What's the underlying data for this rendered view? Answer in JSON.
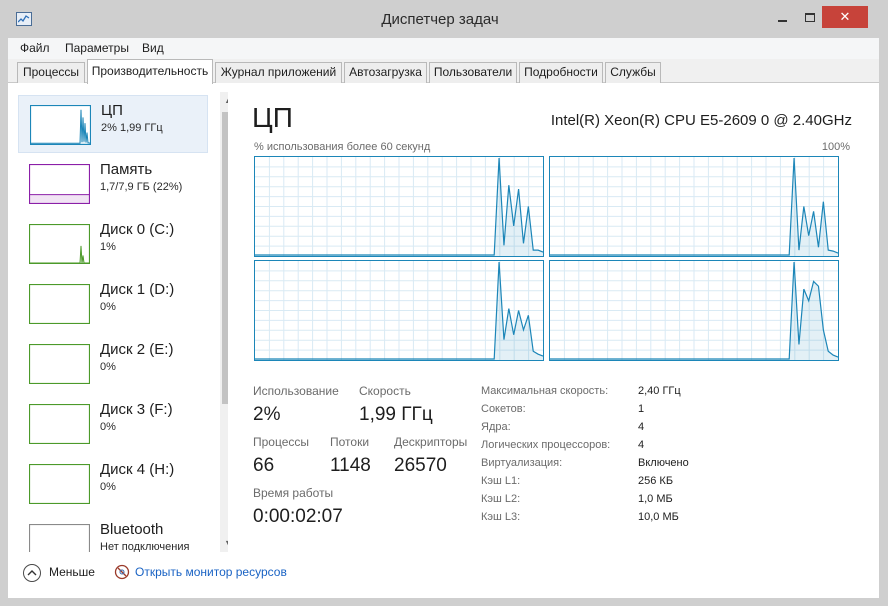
{
  "window": {
    "title": "Диспетчер задач",
    "controls": {
      "minimize": "",
      "maximize": "",
      "close": "✕"
    }
  },
  "menu": [
    "Файл",
    "Параметры",
    "Вид"
  ],
  "tabs": [
    {
      "label": "Процессы",
      "active": false
    },
    {
      "label": "Производительность",
      "active": true
    },
    {
      "label": "Журнал приложений",
      "active": false
    },
    {
      "label": "Автозагрузка",
      "active": false
    },
    {
      "label": "Пользователи",
      "active": false
    },
    {
      "label": "Подробности",
      "active": false
    },
    {
      "label": "Службы",
      "active": false
    }
  ],
  "sidebar": {
    "items": [
      {
        "name": "ЦП",
        "value": "2% 1,99 ГГц",
        "color": "#1c86b8",
        "selected": true,
        "series": [
          2,
          2,
          2,
          2,
          2,
          2,
          2,
          2,
          2,
          2,
          2,
          2,
          2,
          2,
          2,
          2,
          2,
          2,
          2,
          2,
          2,
          2,
          2,
          2,
          2,
          2,
          2,
          2,
          2,
          2,
          2,
          2,
          2,
          2,
          2,
          2,
          2,
          2,
          2,
          2,
          2,
          2,
          2,
          2,
          2,
          2,
          2,
          2,
          2,
          2,
          90,
          5,
          70,
          6,
          55,
          4,
          30,
          3,
          3,
          2
        ]
      },
      {
        "name": "Память",
        "value": "1,7/7,9 ГБ (22%)",
        "color": "#8b1fa8",
        "selected": false,
        "series": [
          22,
          22,
          22,
          22,
          22,
          22,
          22,
          22,
          22,
          22,
          22,
          22,
          22,
          22,
          22,
          22,
          22,
          22,
          22,
          22,
          22,
          22,
          22,
          22,
          22,
          22,
          22,
          22,
          22,
          22,
          22,
          22,
          22,
          22,
          22,
          22,
          22,
          22,
          22,
          22,
          22,
          22,
          22,
          22,
          22,
          22,
          22,
          22,
          22,
          22,
          22,
          22,
          22,
          22,
          22,
          22,
          22,
          22,
          22,
          22
        ]
      },
      {
        "name": "Диск 0 (C:)",
        "value": "1%",
        "color": "#4c9a2a",
        "selected": false,
        "series": [
          0,
          0,
          0,
          0,
          0,
          0,
          0,
          0,
          0,
          0,
          0,
          0,
          0,
          0,
          0,
          0,
          0,
          0,
          0,
          0,
          0,
          0,
          0,
          0,
          0,
          0,
          0,
          0,
          0,
          0,
          0,
          0,
          0,
          0,
          0,
          0,
          0,
          0,
          0,
          0,
          0,
          0,
          0,
          0,
          0,
          0,
          0,
          0,
          0,
          0,
          0,
          45,
          0,
          20,
          0,
          0,
          0,
          0,
          0,
          0
        ]
      },
      {
        "name": "Диск 1 (D:)",
        "value": "0%",
        "color": "#4c9a2a",
        "selected": false,
        "series": []
      },
      {
        "name": "Диск 2 (E:)",
        "value": "0%",
        "color": "#4c9a2a",
        "selected": false,
        "series": []
      },
      {
        "name": "Диск 3 (F:)",
        "value": "0%",
        "color": "#4c9a2a",
        "selected": false,
        "series": []
      },
      {
        "name": "Диск 4 (H:)",
        "value": "0%",
        "color": "#4c9a2a",
        "selected": false,
        "series": []
      },
      {
        "name": "Bluetooth",
        "value": "Нет подключения",
        "color": "#8a8a8a",
        "selected": false,
        "series": []
      }
    ]
  },
  "main": {
    "title": "ЦП",
    "cpu_model": "Intel(R) Xeon(R) CPU E5-2609 0 @ 2.40GHz",
    "graph_label": "% использования более 60 секунд",
    "graph_max": "100%",
    "line_color": "#1c86b8",
    "cores": [
      [
        0,
        0,
        0,
        0,
        0,
        0,
        0,
        0,
        0,
        0,
        0,
        0,
        0,
        0,
        0,
        0,
        0,
        0,
        0,
        0,
        0,
        0,
        0,
        0,
        0,
        0,
        0,
        0,
        0,
        0,
        0,
        0,
        0,
        0,
        0,
        0,
        0,
        0,
        0,
        0,
        0,
        0,
        0,
        0,
        0,
        0,
        0,
        0,
        0,
        0,
        100,
        10,
        72,
        30,
        68,
        12,
        50,
        5,
        5,
        3
      ],
      [
        0,
        0,
        0,
        0,
        0,
        0,
        0,
        0,
        0,
        0,
        0,
        0,
        0,
        0,
        0,
        0,
        0,
        0,
        0,
        0,
        0,
        0,
        0,
        0,
        0,
        0,
        0,
        0,
        0,
        0,
        0,
        0,
        0,
        0,
        0,
        0,
        0,
        0,
        0,
        0,
        0,
        0,
        0,
        0,
        0,
        0,
        0,
        0,
        0,
        0,
        100,
        5,
        50,
        20,
        45,
        8,
        55,
        5,
        4,
        2
      ],
      [
        0,
        0,
        0,
        0,
        0,
        0,
        0,
        0,
        0,
        0,
        0,
        0,
        0,
        0,
        0,
        0,
        0,
        0,
        0,
        0,
        0,
        0,
        0,
        0,
        0,
        0,
        0,
        0,
        0,
        0,
        0,
        0,
        0,
        0,
        0,
        0,
        0,
        0,
        0,
        0,
        0,
        0,
        0,
        0,
        0,
        0,
        0,
        0,
        0,
        0,
        100,
        20,
        52,
        25,
        50,
        30,
        45,
        8,
        5,
        3
      ],
      [
        0,
        0,
        0,
        0,
        0,
        0,
        0,
        0,
        0,
        0,
        0,
        0,
        0,
        0,
        0,
        0,
        0,
        0,
        0,
        0,
        0,
        0,
        0,
        0,
        0,
        0,
        0,
        0,
        0,
        0,
        0,
        0,
        0,
        0,
        0,
        0,
        0,
        0,
        0,
        0,
        0,
        0,
        0,
        0,
        0,
        0,
        0,
        0,
        0,
        0,
        100,
        15,
        72,
        60,
        80,
        75,
        30,
        8,
        4,
        2
      ]
    ],
    "stats": {
      "usage_label": "Использование",
      "usage": "2%",
      "speed_label": "Скорость",
      "speed": "1,99 ГГц",
      "processes_label": "Процессы",
      "processes": "66",
      "threads_label": "Потоки",
      "threads": "1148",
      "handles_label": "Дескрипторы",
      "handles": "26570",
      "uptime_label": "Время работы",
      "uptime": "0:00:02:07"
    },
    "specs": [
      {
        "label": "Максимальная скорость:",
        "value": "2,40 ГГц"
      },
      {
        "label": "Сокетов:",
        "value": "1"
      },
      {
        "label": "Ядра:",
        "value": "4"
      },
      {
        "label": "Логических процессоров:",
        "value": "4"
      },
      {
        "label": "Виртуализация:",
        "value": "Включено"
      },
      {
        "label": "Кэш L1:",
        "value": "256 КБ"
      },
      {
        "label": "Кэш L2:",
        "value": "1,0 МБ"
      },
      {
        "label": "Кэш L3:",
        "value": "10,0 МБ"
      }
    ]
  },
  "footer": {
    "less_label": "Меньше",
    "resmon_label": "Открыть монитор ресурсов"
  }
}
